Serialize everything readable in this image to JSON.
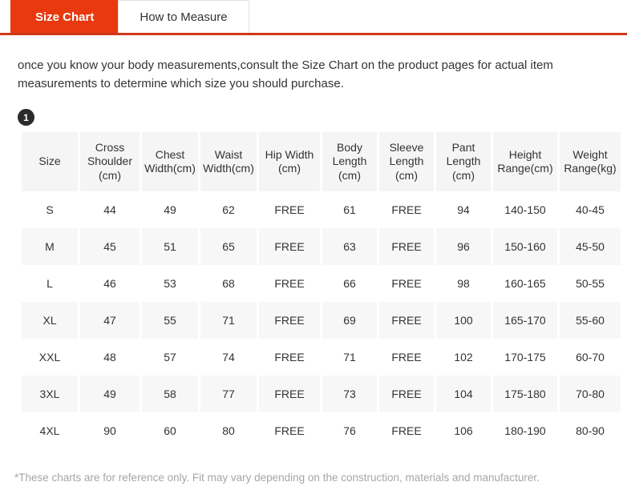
{
  "tabs": [
    {
      "label": "Size Chart",
      "active": true
    },
    {
      "label": "How to Measure",
      "active": false
    }
  ],
  "accent_color": "#e8390f",
  "accent_border_color": "#cf3818",
  "intro": {
    "text": "once you know your body measurements,consult the Size Chart on the product pages for actual item measurements to determine which size you should purchase."
  },
  "badge": {
    "label": "1"
  },
  "chart_data": {
    "type": "table",
    "title": "Size Chart",
    "columns": [
      "Size",
      "Cross Shoulder (cm)",
      "Chest Width(cm)",
      "Waist Width(cm)",
      "Hip Width (cm)",
      "Body Length (cm)",
      "Sleeve Length (cm)",
      "Pant Length (cm)",
      "Height Range(cm)",
      "Weight Range(kg)"
    ],
    "column_lines": [
      [
        "Size"
      ],
      [
        "Cross",
        "Shoulder",
        "(cm)"
      ],
      [
        "Chest",
        "Width(cm)"
      ],
      [
        "Waist",
        "Width(cm)"
      ],
      [
        "Hip Width",
        "(cm)"
      ],
      [
        "Body",
        "Length",
        "(cm)"
      ],
      [
        "Sleeve",
        "Length",
        "(cm)"
      ],
      [
        "Pant",
        "Length",
        "(cm)"
      ],
      [
        "Height",
        "Range(cm)"
      ],
      [
        "Weight",
        "Range(kg)"
      ]
    ],
    "rows": [
      [
        "S",
        "44",
        "49",
        "62",
        "FREE",
        "61",
        "FREE",
        "94",
        "140-150",
        "40-45"
      ],
      [
        "M",
        "45",
        "51",
        "65",
        "FREE",
        "63",
        "FREE",
        "96",
        "150-160",
        "45-50"
      ],
      [
        "L",
        "46",
        "53",
        "68",
        "FREE",
        "66",
        "FREE",
        "98",
        "160-165",
        "50-55"
      ],
      [
        "XL",
        "47",
        "55",
        "71",
        "FREE",
        "69",
        "FREE",
        "100",
        "165-170",
        "55-60"
      ],
      [
        "XXL",
        "48",
        "57",
        "74",
        "FREE",
        "71",
        "FREE",
        "102",
        "170-175",
        "60-70"
      ],
      [
        "3XL",
        "49",
        "58",
        "77",
        "FREE",
        "73",
        "FREE",
        "104",
        "175-180",
        "70-80"
      ],
      [
        "4XL",
        "90",
        "60",
        "80",
        "FREE",
        "76",
        "FREE",
        "106",
        "180-190",
        "80-90"
      ]
    ]
  },
  "footnote": {
    "text": "*These charts are for reference only. Fit may vary depending on the construction, materials and manufacturer."
  }
}
